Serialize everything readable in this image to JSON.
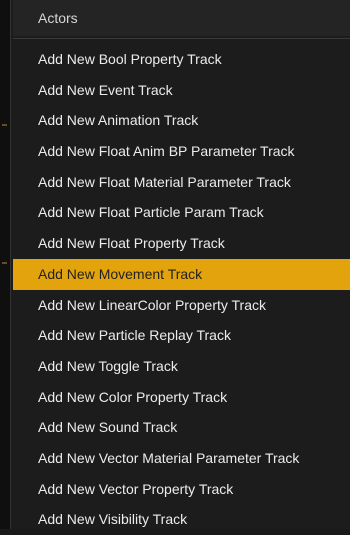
{
  "menu": {
    "header": "Actors",
    "items": [
      {
        "label": "Add New Bool Property Track"
      },
      {
        "label": "Add New Event Track"
      },
      {
        "label": "Add New Animation Track"
      },
      {
        "label": "Add New Float Anim BP Parameter Track"
      },
      {
        "label": "Add New Float Material Parameter Track"
      },
      {
        "label": "Add New Float Particle Param Track"
      },
      {
        "label": "Add New Float Property Track"
      },
      {
        "label": "Add New Movement Track"
      },
      {
        "label": "Add New LinearColor Property Track"
      },
      {
        "label": "Add New Particle Replay Track"
      },
      {
        "label": "Add New Toggle Track"
      },
      {
        "label": "Add New Color Property Track"
      },
      {
        "label": "Add New Sound Track"
      },
      {
        "label": "Add New Vector Material Parameter Track"
      },
      {
        "label": "Add New Vector Property Track"
      },
      {
        "label": "Add New Visibility Track"
      }
    ],
    "selected_index": 7,
    "colors": {
      "background": "#1c1c1c",
      "highlight": "#e2a30d",
      "text": "#ececec"
    }
  }
}
